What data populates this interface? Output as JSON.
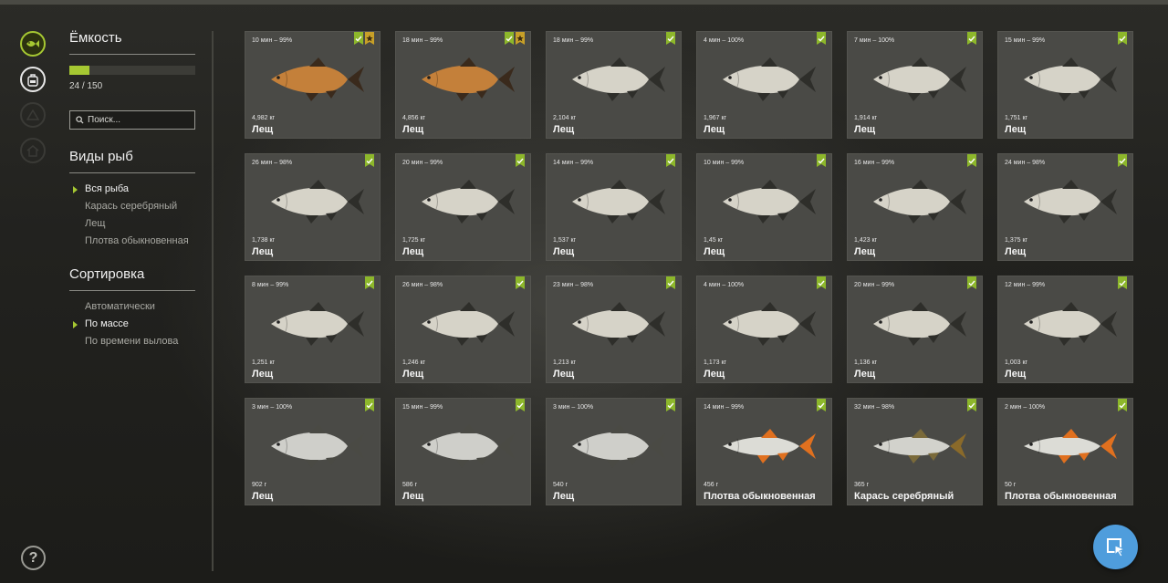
{
  "sidebar": {
    "capacity_title": "Ёмкость",
    "capacity_text": "24 / 150",
    "capacity_fraction": 0.16,
    "search_placeholder": "Поиск...",
    "species_title": "Виды рыб",
    "species": [
      {
        "label": "Вся рыба",
        "selected": true
      },
      {
        "label": "Карась серебряный",
        "selected": false
      },
      {
        "label": "Лещ",
        "selected": false
      },
      {
        "label": "Плотва обыкновенная",
        "selected": false
      }
    ],
    "sort_title": "Сортировка",
    "sort": [
      {
        "label": "Автоматически",
        "selected": false
      },
      {
        "label": "По массе",
        "selected": true
      },
      {
        "label": "По времени вылова",
        "selected": false
      }
    ]
  },
  "rail_icons": [
    "fish-icon",
    "backpack-icon",
    "tent-icon",
    "house-icon",
    "help-icon"
  ],
  "colors": {
    "accent": "#a6c832",
    "fab": "#4f9ddc",
    "card": "#4a4a46"
  },
  "fish_cards": [
    {
      "meta": "10 мин – 99%",
      "weight": "4,982 кг",
      "name": "Лещ",
      "kind": "bream-gold",
      "star": true
    },
    {
      "meta": "18 мин – 99%",
      "weight": "4,856 кг",
      "name": "Лещ",
      "kind": "bream-gold",
      "star": true
    },
    {
      "meta": "18 мин – 99%",
      "weight": "2,104 кг",
      "name": "Лещ",
      "kind": "bream",
      "star": false
    },
    {
      "meta": "4 мин – 100%",
      "weight": "1,967 кг",
      "name": "Лещ",
      "kind": "bream",
      "star": false
    },
    {
      "meta": "7 мин – 100%",
      "weight": "1,914 кг",
      "name": "Лещ",
      "kind": "bream",
      "star": false
    },
    {
      "meta": "15 мин – 99%",
      "weight": "1,751 кг",
      "name": "Лещ",
      "kind": "bream",
      "star": false
    },
    {
      "meta": "26 мин – 98%",
      "weight": "1,738 кг",
      "name": "Лещ",
      "kind": "bream",
      "star": false
    },
    {
      "meta": "20 мин – 99%",
      "weight": "1,725 кг",
      "name": "Лещ",
      "kind": "bream",
      "star": false
    },
    {
      "meta": "14 мин – 99%",
      "weight": "1,537 кг",
      "name": "Лещ",
      "kind": "bream",
      "star": false
    },
    {
      "meta": "10 мин – 99%",
      "weight": "1,45 кг",
      "name": "Лещ",
      "kind": "bream",
      "star": false
    },
    {
      "meta": "16 мин – 99%",
      "weight": "1,423 кг",
      "name": "Лещ",
      "kind": "bream",
      "star": false
    },
    {
      "meta": "24 мин – 98%",
      "weight": "1,375 кг",
      "name": "Лещ",
      "kind": "bream",
      "star": false
    },
    {
      "meta": "8 мин – 99%",
      "weight": "1,251 кг",
      "name": "Лещ",
      "kind": "bream",
      "star": false
    },
    {
      "meta": "26 мин – 98%",
      "weight": "1,246 кг",
      "name": "Лещ",
      "kind": "bream",
      "star": false
    },
    {
      "meta": "23 мин – 98%",
      "weight": "1,213 кг",
      "name": "Лещ",
      "kind": "bream",
      "star": false
    },
    {
      "meta": "4 мин – 100%",
      "weight": "1,173 кг",
      "name": "Лещ",
      "kind": "bream",
      "star": false
    },
    {
      "meta": "20 мин – 99%",
      "weight": "1,136 кг",
      "name": "Лещ",
      "kind": "bream",
      "star": false
    },
    {
      "meta": "12 мин – 99%",
      "weight": "1,003 кг",
      "name": "Лещ",
      "kind": "bream",
      "star": false
    },
    {
      "meta": "3 мин – 100%",
      "weight": "902 г",
      "name": "Лещ",
      "kind": "bream-silver",
      "star": false
    },
    {
      "meta": "15 мин – 99%",
      "weight": "586 г",
      "name": "Лещ",
      "kind": "bream-silver",
      "star": false
    },
    {
      "meta": "3 мин – 100%",
      "weight": "540 г",
      "name": "Лещ",
      "kind": "bream-silver",
      "star": false
    },
    {
      "meta": "14 мин – 99%",
      "weight": "456 г",
      "name": "Плотва обыкновенная",
      "kind": "roach",
      "star": false
    },
    {
      "meta": "32 мин – 98%",
      "weight": "365 г",
      "name": "Карась серебряный",
      "kind": "crucian",
      "star": false
    },
    {
      "meta": "2 мин – 100%",
      "weight": "50 г",
      "name": "Плотва обыкновенная",
      "kind": "roach",
      "star": false
    }
  ]
}
